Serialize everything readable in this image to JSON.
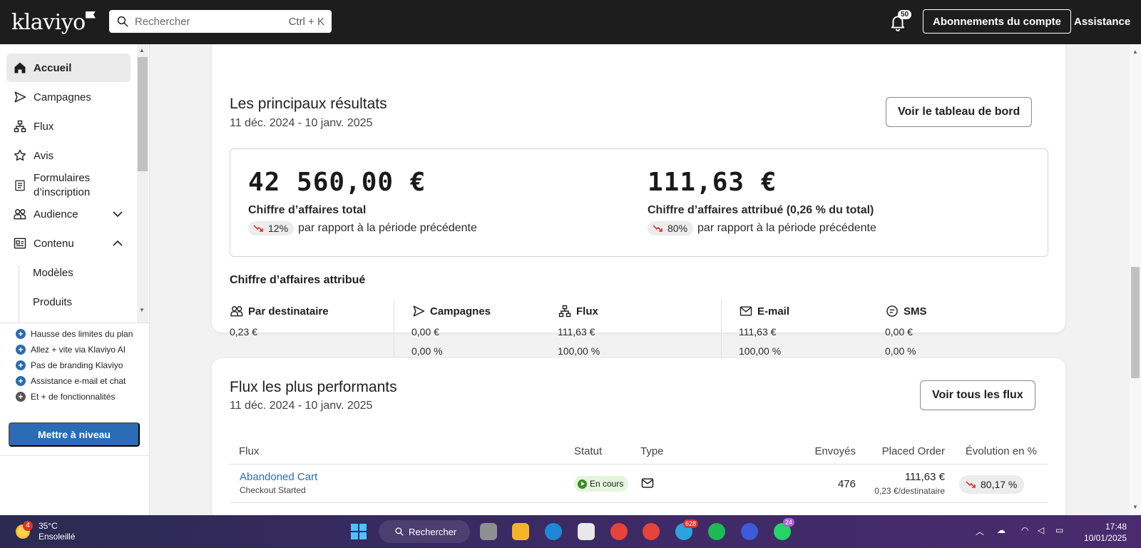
{
  "app": {
    "logo": "klaviyo"
  },
  "topbar": {
    "search_placeholder": "Rechercher",
    "search_shortcut": "Ctrl + K",
    "notification_count": "50",
    "account_button": "Abonnements du compte",
    "help_link": "Assistance"
  },
  "sidebar": {
    "items": [
      {
        "label": "Accueil",
        "icon": "home-icon",
        "active": true
      },
      {
        "label": "Campagnes",
        "icon": "send-icon"
      },
      {
        "label": "Flux",
        "icon": "flow-icon"
      },
      {
        "label": "Avis",
        "icon": "star-icon"
      },
      {
        "label": "Formulaires d’inscription",
        "icon": "form-icon"
      },
      {
        "label": "Audience",
        "icon": "audience-icon",
        "expandable": "collapsed"
      },
      {
        "label": "Contenu",
        "icon": "content-icon",
        "expandable": "expanded"
      }
    ],
    "subitems": [
      "Modèles",
      "Produits"
    ],
    "perks": [
      "Hausse des limites du plan",
      "Allez + vite via Klaviyo AI",
      "Pas de branding Klaviyo",
      "Assistance e-mail et chat",
      "Et + de fonctionnalités"
    ],
    "upgrade_button": "Mettre à niveau"
  },
  "results_card": {
    "title": "Les principaux résultats",
    "date_range": "11 déc. 2024 - 10 janv. 2025",
    "dashboard_button": "Voir le tableau de bord",
    "kpis": [
      {
        "value": "42 560,00 €",
        "label": "Chiffre d’affaires total",
        "change": "12%",
        "trend": "down",
        "comparison": "par rapport à la période précédente"
      },
      {
        "value": "111,63 €",
        "label": "Chiffre d’affaires attribué (0,26 % du total)",
        "change": "80%",
        "trend": "down",
        "comparison": "par rapport à la période précédente"
      }
    ],
    "attributed_title": "Chiffre d’affaires attribué",
    "attributed": [
      {
        "label": "Par destinataire",
        "icon": "audience-icon",
        "value": "0,23 €",
        "percent": ""
      },
      {
        "label": "Campagnes",
        "icon": "send-icon",
        "value": "0,00 €",
        "percent": "0,00 %"
      },
      {
        "label": "Flux",
        "icon": "flow-icon",
        "value": "111,63 €",
        "percent": "100,00 %"
      },
      {
        "label": "E-mail",
        "icon": "mail-icon",
        "value": "111,63 €",
        "percent": "100,00 %"
      },
      {
        "label": "SMS",
        "icon": "sms-icon",
        "value": "0,00 €",
        "percent": "0,00 %"
      }
    ]
  },
  "flows_card": {
    "title": "Flux les plus performants",
    "date_range": "11 déc. 2024 - 10 janv. 2025",
    "all_flows_button": "Voir tous les flux",
    "columns": [
      "Flux",
      "Statut",
      "Type",
      "Envoyés",
      "Placed Order",
      "Évolution en %"
    ],
    "rows": [
      {
        "name": "Abandoned Cart",
        "trigger": "Checkout Started",
        "status": "En cours",
        "type_icon": "mail-icon",
        "sent": "476",
        "placed_order": "111,63 €",
        "per_recipient": "0,23 €/destinataire",
        "evolution": "80,17 %",
        "trend": "down"
      }
    ]
  },
  "taskbar": {
    "weather_temp": "35°C",
    "weather_desc": "Ensoleillé",
    "weather_badge": "4",
    "search_label": "Rechercher",
    "telegram_badge": "628",
    "whatsapp_badge": "24",
    "time": "17:48",
    "date": "10/01/2025"
  },
  "colors": {
    "accent": "#2a6cb6",
    "trend_down": "#d9342b",
    "status_running": "#3a8a27",
    "topbar": "#1d1d1d"
  }
}
